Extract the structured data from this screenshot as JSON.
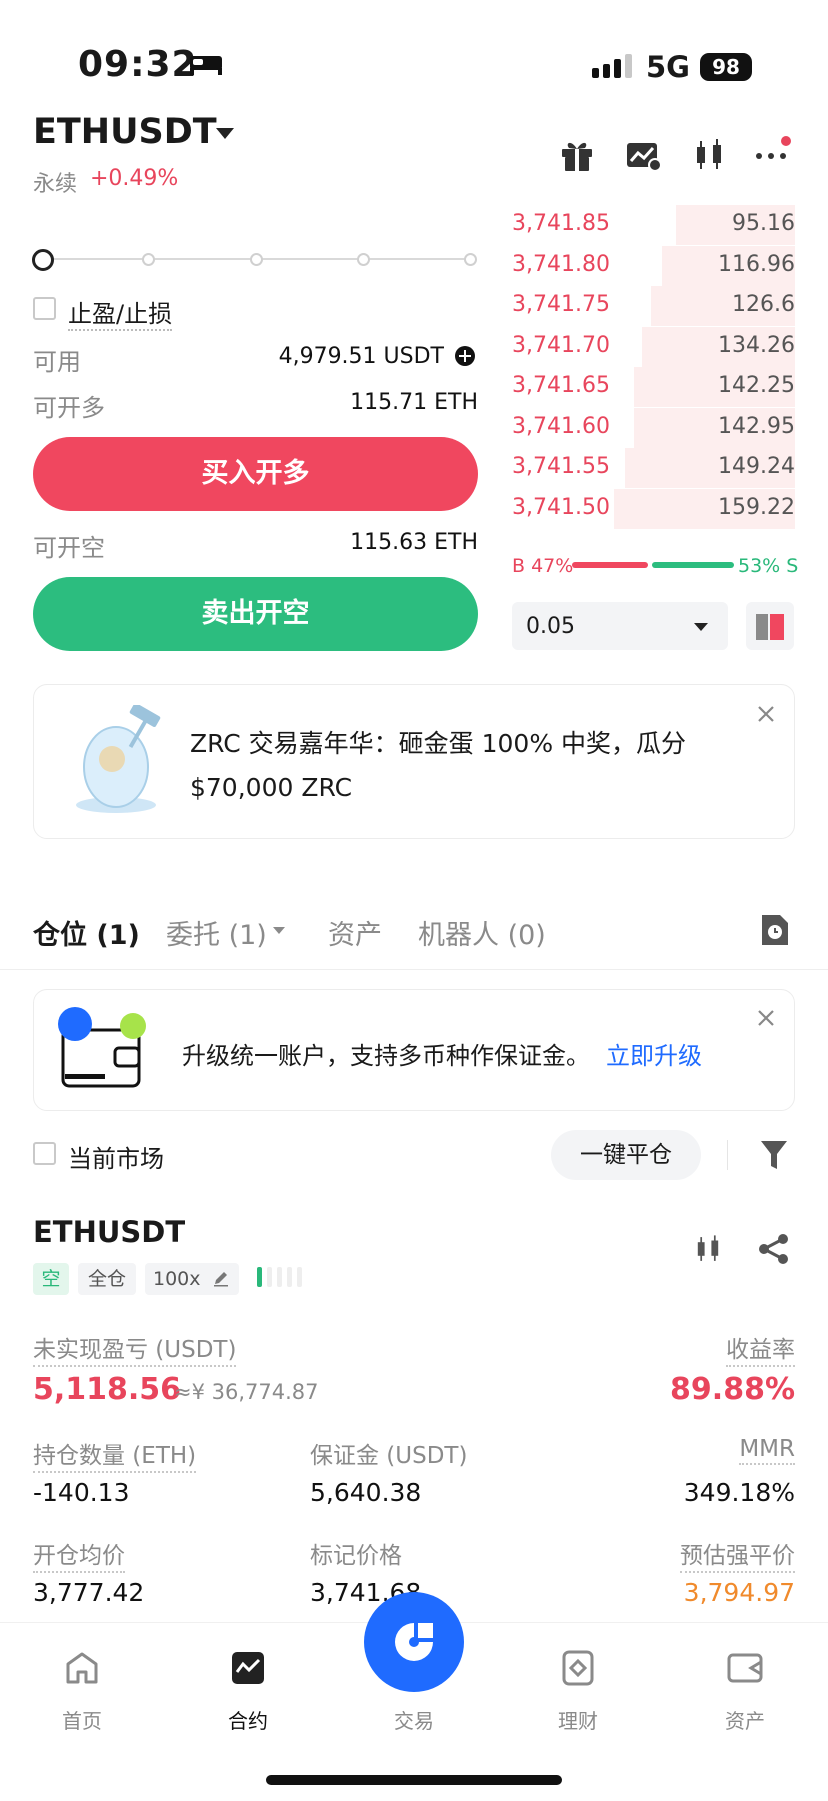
{
  "status_bar": {
    "time": "09:32",
    "network": "5G",
    "battery": "98"
  },
  "header": {
    "pair": "ETHUSDT",
    "type": "永续",
    "change": "+0.49%"
  },
  "order_form": {
    "tp_sl_label": "止盈/止损",
    "available_label": "可用",
    "available_value": "4,979.51 USDT",
    "can_long_label": "可开多",
    "can_long_value": "115.71 ETH",
    "buy_button": "买入开多",
    "can_short_label": "可开空",
    "can_short_value": "115.63 ETH",
    "sell_button": "卖出开空"
  },
  "order_book": {
    "asks": [
      {
        "price": "3,741.85",
        "qty": "95.16",
        "depth": 0.42
      },
      {
        "price": "3,741.80",
        "qty": "116.96",
        "depth": 0.47
      },
      {
        "price": "3,741.75",
        "qty": "126.6",
        "depth": 0.51
      },
      {
        "price": "3,741.70",
        "qty": "134.26",
        "depth": 0.54
      },
      {
        "price": "3,741.65",
        "qty": "142.25",
        "depth": 0.57
      },
      {
        "price": "3,741.60",
        "qty": "142.95",
        "depth": 0.57
      },
      {
        "price": "3,741.55",
        "qty": "149.24",
        "depth": 0.6
      },
      {
        "price": "3,741.50",
        "qty": "159.22",
        "depth": 0.64
      }
    ],
    "buy_ratio": "B 47%",
    "sell_ratio": "53% S",
    "buy_pct": 47,
    "precision": "0.05"
  },
  "promo": {
    "text": "ZRC 交易嘉年华：砸金蛋 100% 中奖，瓜分 $70,000 ZRC"
  },
  "tabs": {
    "positions": "仓位 (1)",
    "orders": "委托 (1)",
    "assets": "资产",
    "bots": "机器人 (0)"
  },
  "upgrade": {
    "text": "升级统一账户，支持多币种作保证金。",
    "link": "立即升级"
  },
  "filter": {
    "current_market": "当前市场",
    "close_all": "一键平仓"
  },
  "position": {
    "symbol": "ETHUSDT",
    "side": "空",
    "margin_mode": "全仓",
    "leverage": "100x",
    "upl_label": "未实现盈亏 (USDT)",
    "upl_value": "5,118.56",
    "upl_cny": "≈¥ 36,774.87",
    "roe_label": "收益率",
    "roe_value": "89.88%",
    "size_label": "持仓数量 (ETH)",
    "size_value": "-140.13",
    "margin_label": "保证金 (USDT)",
    "margin_value": "5,640.38",
    "mmr_label": "MMR",
    "mmr_value": "349.18%",
    "entry_label": "开仓均价",
    "entry_value": "3,777.42",
    "mark_label": "标记价格",
    "mark_value": "3,741.68",
    "liq_label": "预估强平价",
    "liq_value": "3,794.97"
  },
  "nav": {
    "home": "首页",
    "futures": "合约",
    "trade": "交易",
    "earn": "理财",
    "assets": "资产"
  }
}
